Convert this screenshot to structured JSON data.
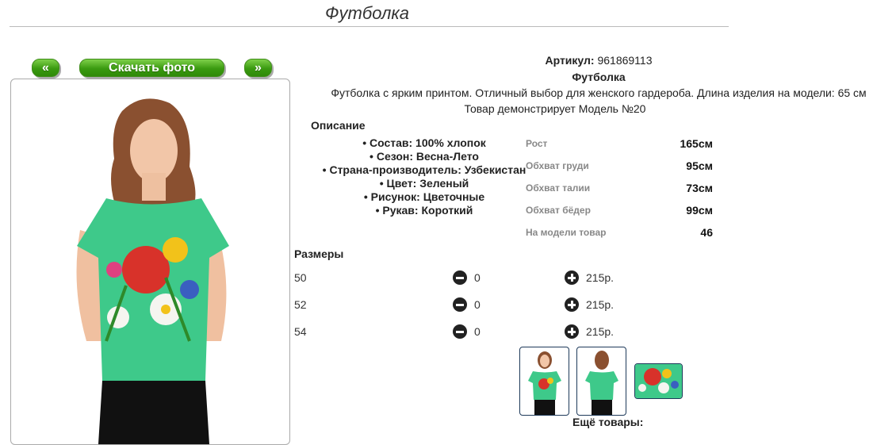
{
  "page": {
    "title": "Футболка"
  },
  "gallery": {
    "prev_label": "«",
    "download_label": "Скачать фото",
    "next_label": "»"
  },
  "product": {
    "article_label": "Артикул:",
    "article_value": "961869113",
    "name": "Футболка",
    "description": "Футболка с ярким принтом. Отличный выбор для женского гардероба. Длина изделия на модели: 65 см",
    "model_line": "Товар демонстрирует Модель №20"
  },
  "description": {
    "heading": "Описание",
    "items": [
      "Состав: 100% хлопок",
      "Сезон: Весна-Лето",
      "Страна-производитель: Узбекистан",
      "Цвет: Зеленый",
      "Рисунок: Цветочные",
      "Рукав: Короткий"
    ]
  },
  "measurements": [
    {
      "label": "Рост",
      "value": "165см"
    },
    {
      "label": "Обхват груди",
      "value": "95см"
    },
    {
      "label": "Обхват талии",
      "value": "73см"
    },
    {
      "label": "Обхват бёдер",
      "value": "99см"
    },
    {
      "label": "На модели товар",
      "value": "46"
    }
  ],
  "sizes": {
    "heading": "Размеры",
    "rows": [
      {
        "size": "50",
        "qty": "0",
        "price": "215р."
      },
      {
        "size": "52",
        "qty": "0",
        "price": "215р."
      },
      {
        "size": "54",
        "qty": "0",
        "price": "215р."
      }
    ]
  },
  "more": {
    "label": "Ещё товары:"
  },
  "colors": {
    "accent_green": "#3a9a10",
    "shirt": "#3ec98a",
    "thumb_border": "#1e3a5a"
  },
  "icons": {
    "minus": "minus-circle-icon",
    "plus": "plus-circle-icon"
  }
}
